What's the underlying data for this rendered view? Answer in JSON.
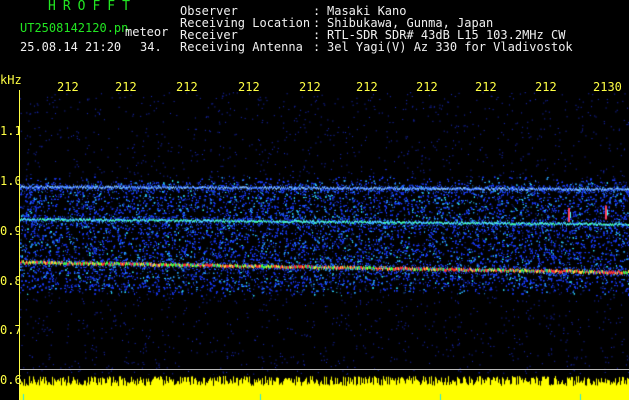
{
  "header": {
    "brand": "HROFFT",
    "filename": "UT2508142120.pn",
    "mode": "meteor",
    "datetime": "25.08.14 21:20",
    "count": "34.",
    "info": [
      {
        "label": "Observer",
        "value": "Masaki Kano"
      },
      {
        "label": "Receiving Location",
        "value": "Shibukawa, Gunma, Japan"
      },
      {
        "label": "Receiver",
        "value": "RTL-SDR SDR# 43dB L15 103.2MHz CW"
      },
      {
        "label": "Receiving Antenna",
        "value": "3el Yagi(V) Az 330 for Vladivostok"
      }
    ],
    "separator": ":"
  },
  "axes": {
    "unit": "kHz",
    "time_ticks": [
      "212",
      "212",
      "212",
      "212",
      "212",
      "212",
      "212",
      "212",
      "212",
      "2130"
    ],
    "freq_ticks": [
      "1.1",
      "1.0",
      "0.9",
      "0.8",
      "0.7",
      "0.6"
    ]
  },
  "colors": {
    "header_green": "#22e622",
    "label_yellow": "#ffff44",
    "text_white": "#f0f0f0",
    "noise_blue": "#1a3cff",
    "signal_green": "#40ff40",
    "signal_red": "#ff3030",
    "power_yellow": "#ffff00"
  },
  "chart_data": {
    "type": "heatmap",
    "title": "",
    "xlabel": "",
    "ylabel": "kHz",
    "x_tick_labels": [
      "212",
      "212",
      "212",
      "212",
      "212",
      "212",
      "212",
      "212",
      "212",
      "2130"
    ],
    "ylim": [
      0.6,
      1.15
    ],
    "y_tick_values": [
      1.1,
      1.0,
      0.9,
      0.8,
      0.7,
      0.6
    ],
    "noise_band_khz": [
      0.78,
      1.0
    ],
    "signal_lines_khz": [
      {
        "start": 0.84,
        "end": 0.82,
        "strength": "strong"
      },
      {
        "start": 0.925,
        "end": 0.915,
        "strength": "medium"
      },
      {
        "start": 0.99,
        "end": 0.985,
        "strength": "weak"
      }
    ]
  }
}
